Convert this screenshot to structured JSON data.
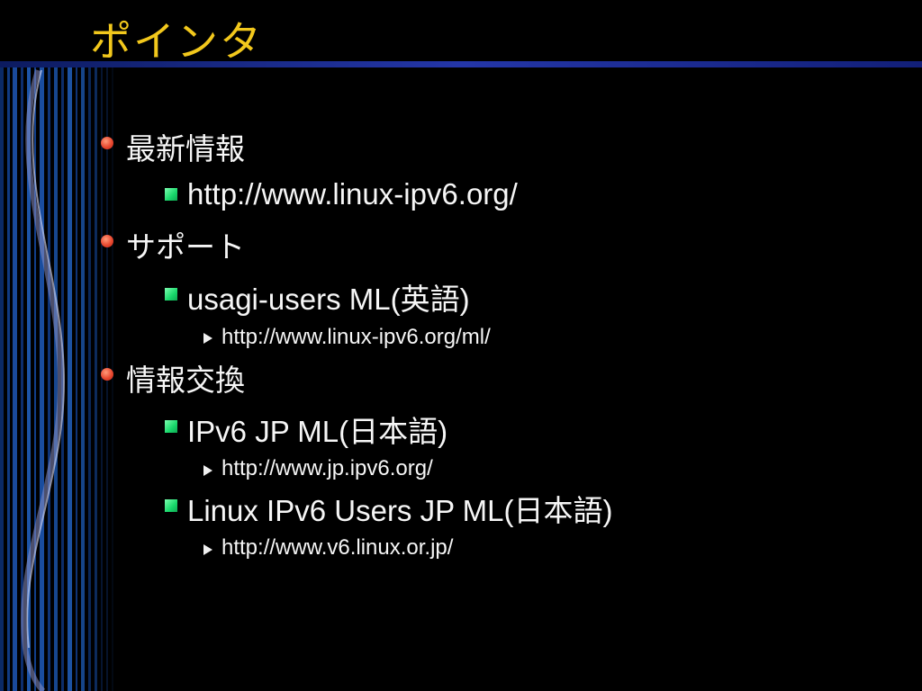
{
  "slide": {
    "title": "ポインタ",
    "items": [
      {
        "label": "最新情報",
        "children": [
          {
            "label": "http://www.linux-ipv6.org/",
            "children": []
          }
        ]
      },
      {
        "label": "サポート",
        "children": [
          {
            "label": "usagi-users ML(英語)",
            "children": [
              {
                "label": "http://www.linux-ipv6.org/ml/"
              }
            ]
          }
        ]
      },
      {
        "label": "情報交換",
        "children": [
          {
            "label": "IPv6 JP ML(日本語)",
            "children": [
              {
                "label": "http://www.jp.ipv6.org/"
              }
            ]
          },
          {
            "label": "Linux IPv6 Users JP ML(日本語)",
            "children": [
              {
                "label": "http://www.v6.linux.or.jp/"
              }
            ]
          }
        ]
      }
    ]
  },
  "colors": {
    "background": "#000000",
    "title": "#f2c81c",
    "rule": "#1c2a8c",
    "text": "#f6f6f6",
    "bullet_level1": "#e8482f",
    "bullet_level2": "#18d86b",
    "bullet_level3": "#f0f0f0"
  }
}
